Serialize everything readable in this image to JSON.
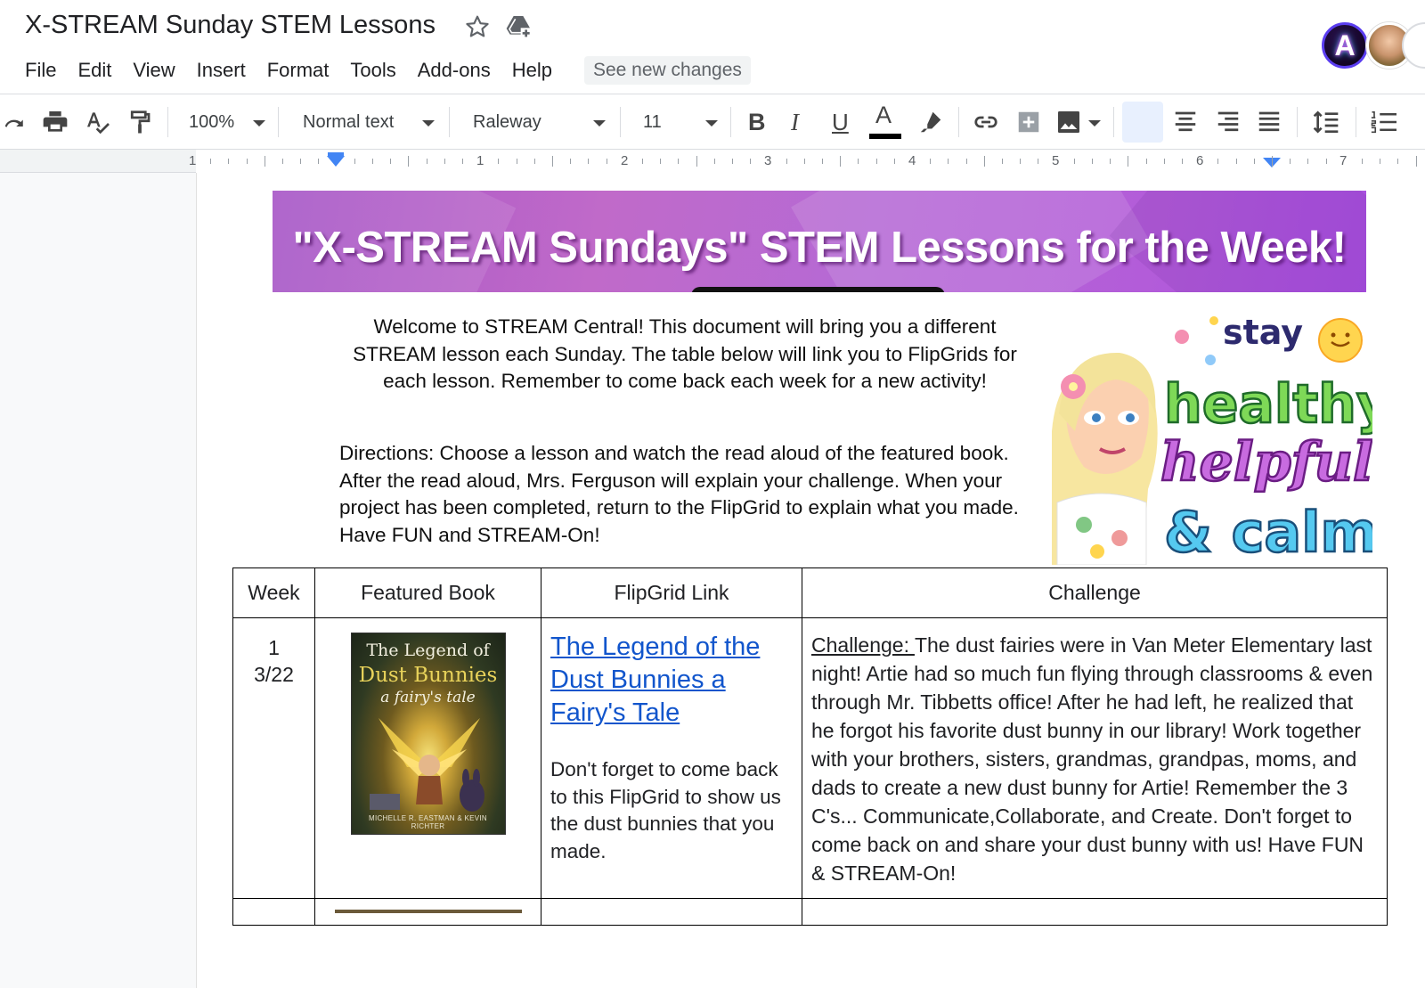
{
  "app": {
    "doc_title": "X-STREAM Sunday STEM Lessons",
    "menu": [
      "File",
      "Edit",
      "View",
      "Insert",
      "Format",
      "Tools",
      "Add-ons",
      "Help"
    ],
    "see_changes": "See new changes",
    "avatar_initial": "A"
  },
  "toolbar": {
    "zoom": "100%",
    "style": "Normal text",
    "font": "Raleway",
    "font_size": "11",
    "bold": "B",
    "italic": "I",
    "underline": "U",
    "text_color_glyph": "A",
    "text_color": "#000000"
  },
  "ruler": {
    "labels": [
      "1",
      "1",
      "2",
      "3",
      "4",
      "5",
      "6",
      "7"
    ]
  },
  "document": {
    "banner_title": "\"X-STREAM Sundays\" STEM Lessons for the Week!",
    "welcome": "Welcome to STREAM Central!  This document will bring you a different STREAM lesson each Sunday.  The table below will link you to FlipGrids for each lesson.  Remember to come back each week for a new activity!",
    "directions": "Directions: Choose a lesson and watch the read aloud of the featured book.  After the read aloud, Mrs. Ferguson will explain your challenge. When your project has been completed, return to the FlipGrid to explain what you made.  Have FUN and STREAM-On!",
    "sticker": {
      "line1": "stay",
      "line2": "healthy",
      "line3": "helpful",
      "line4": "& calm"
    },
    "table": {
      "headers": [
        "Week",
        "Featured Book",
        "FlipGrid Link",
        "Challenge"
      ],
      "rows": [
        {
          "week_num": "1",
          "week_date": "3/22",
          "book_cover": {
            "line1": "The Legend of",
            "line2": "Dust Bunnies",
            "line3": "a fairy's tale",
            "authors": "MICHELLE R. EASTMAN & KEVIN RICHTER"
          },
          "link_text": "The Legend of the Dust Bunnies a Fairy's Tale",
          "link_note": "Don't forget to come back to this FlipGrid to show us the dust bunnies that you made.",
          "challenge_label": "Challenge: ",
          "challenge_text": "The dust fairies were in Van Meter Elementary last night! Artie had so much fun flying through classrooms & even through Mr. Tibbetts office! After he had left, he realized that he forgot his favorite dust bunny in our library! Work together with your brothers, sisters, grandmas, grandpas, moms, and dads to create a new dust bunny for Artie!  Remember the 3 C's... Communicate,Collaborate, and Create. Don't forget to come back on and share your dust bunny with us! Have FUN & STREAM-On!"
        }
      ]
    }
  }
}
